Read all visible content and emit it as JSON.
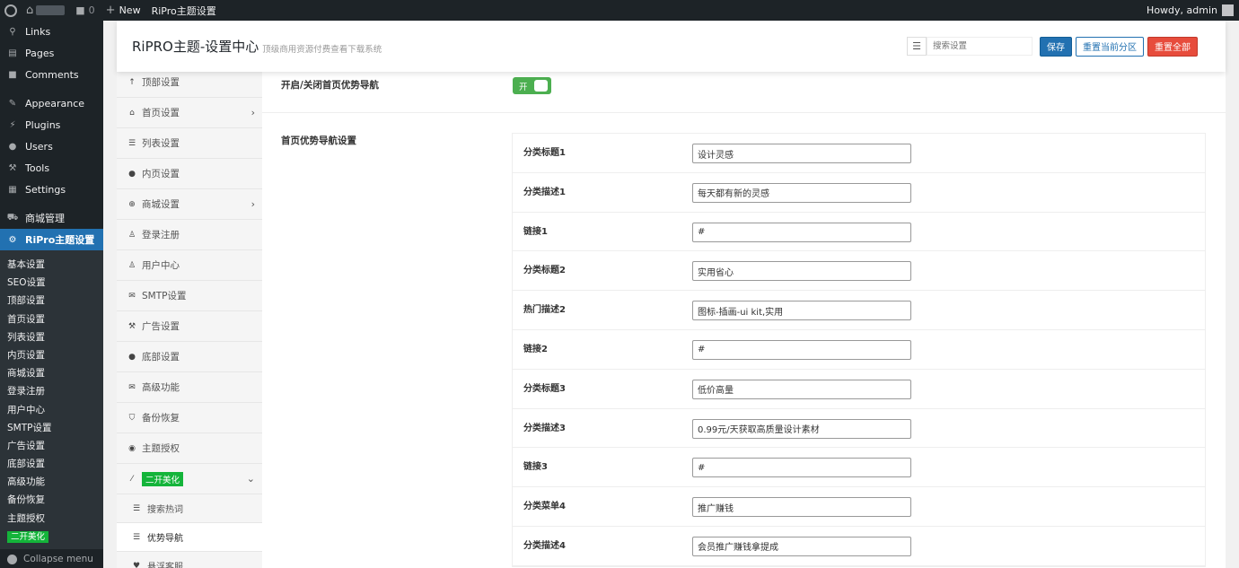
{
  "admin_bar": {
    "new_label": "New",
    "theme_link": "RiPro主题设置",
    "comments_count": "0",
    "greeting": "Howdy, admin"
  },
  "admin_menu": {
    "items": [
      {
        "label": "Links",
        "icon": "link-icon"
      },
      {
        "label": "Pages",
        "icon": "pages-icon"
      },
      {
        "label": "Comments",
        "icon": "comments-icon"
      },
      {
        "label": "Appearance",
        "icon": "appearance-icon"
      },
      {
        "label": "Plugins",
        "icon": "plugins-icon"
      },
      {
        "label": "Users",
        "icon": "users-icon"
      },
      {
        "label": "Tools",
        "icon": "tools-icon"
      },
      {
        "label": "Settings",
        "icon": "settings-icon"
      },
      {
        "label": "商城管理",
        "icon": "cart-icon"
      },
      {
        "label": "RiPro主题设置",
        "icon": "gear-icon"
      }
    ],
    "submenu": [
      "基本设置",
      "SEO设置",
      "顶部设置",
      "首页设置",
      "列表设置",
      "内页设置",
      "商城设置",
      "登录注册",
      "用户中心",
      "SMTP设置",
      "广告设置",
      "底部设置",
      "高级功能",
      "备份恢复",
      "主题授权",
      "二开美化"
    ],
    "collapse_label": "Collapse menu"
  },
  "header": {
    "title": "RiPRO主题-设置中心",
    "subtitle": "顶级商用资源付费查看下载系统",
    "search_placeholder": "搜索设置",
    "save_label": "保存",
    "reset_section_label": "重置当前分区",
    "reset_all_label": "重置全部"
  },
  "nav": {
    "items": [
      {
        "label": "顶部设置",
        "icon": "arrow-up-icon"
      },
      {
        "label": "首页设置",
        "icon": "home-icon",
        "chevron": "›"
      },
      {
        "label": "列表设置",
        "icon": "list-icon"
      },
      {
        "label": "内页设置",
        "icon": "circle-icon"
      },
      {
        "label": "商城设置",
        "icon": "plus-circle-icon",
        "chevron": "›"
      },
      {
        "label": "登录注册",
        "icon": "user-icon"
      },
      {
        "label": "用户中心",
        "icon": "user-icon"
      },
      {
        "label": "SMTP设置",
        "icon": "envelope-icon"
      },
      {
        "label": "广告设置",
        "icon": "hammer-icon"
      },
      {
        "label": "底部设置",
        "icon": "circle-icon"
      },
      {
        "label": "高级功能",
        "icon": "envelope-icon"
      },
      {
        "label": "备份恢复",
        "icon": "shield-icon"
      },
      {
        "label": "主题授权",
        "icon": "eye-icon"
      },
      {
        "label": "二开美化",
        "icon": "wand-icon",
        "chevron": "⌄"
      }
    ],
    "subitems": [
      {
        "label": "搜索热词",
        "icon": "list-icon"
      },
      {
        "label": "优势导航",
        "icon": "list-icon",
        "active": true
      },
      {
        "label": "悬浮客服",
        "icon": "heart-icon"
      }
    ]
  },
  "content": {
    "toggle_label": "开启/关闭首页优势导航",
    "toggle_text": "开",
    "section_label": "首页优势导航设置",
    "fields": [
      {
        "label": "分类标题1",
        "value": "设计灵感"
      },
      {
        "label": "分类描述1",
        "value": "每天都有新的灵感"
      },
      {
        "label": "链接1",
        "value": "#"
      },
      {
        "label": "分类标题2",
        "value": "实用省心"
      },
      {
        "label": "热门描述2",
        "value": "图标-插画-ui kit,实用"
      },
      {
        "label": "链接2",
        "value": "#"
      },
      {
        "label": "分类标题3",
        "value": "低价高量"
      },
      {
        "label": "分类描述3",
        "value": "0.99元/天获取高质量设计素材"
      },
      {
        "label": "链接3",
        "value": "#"
      },
      {
        "label": "分类菜单4",
        "value": "推广赚钱"
      },
      {
        "label": "分类描述4",
        "value": "会员推广赚钱拿提成"
      }
    ]
  }
}
